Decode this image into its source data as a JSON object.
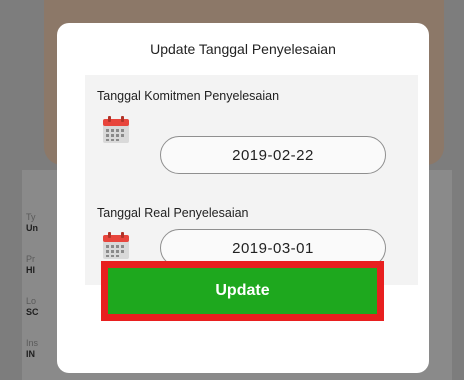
{
  "background": {
    "fields": [
      {
        "label": "Ty",
        "value": "Un"
      },
      {
        "label": "Pr",
        "value": "HI"
      },
      {
        "label": "Lo",
        "value": "SC"
      },
      {
        "label": "Ins",
        "value": "IN"
      }
    ]
  },
  "modal": {
    "title": "Update Tanggal Penyelesaian",
    "commitment": {
      "label": "Tanggal Komitmen Penyelesaian",
      "value": "2019-02-22",
      "icon": "calendar-icon"
    },
    "real": {
      "label": "Tanggal Real Penyelesaian",
      "value": "2019-03-01",
      "icon": "calendar-icon"
    },
    "update_label": "Update"
  },
  "colors": {
    "update_button": "#1ea81e",
    "highlight_outline": "#e81f1f",
    "calendar_accent": "#e8453c"
  }
}
